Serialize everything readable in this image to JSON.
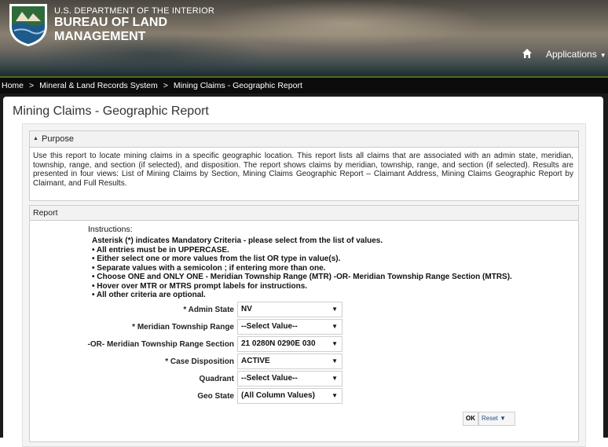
{
  "header": {
    "agency": "U.S. DEPARTMENT OF THE INTERIOR",
    "bureau_line1": "BUREAU OF LAND",
    "bureau_line2": "MANAGEMENT",
    "applications_label": "Applications"
  },
  "breadcrumb": {
    "items": [
      "Home",
      "Mineral & Land Records System",
      "Mining Claims - Geographic Report"
    ],
    "separator": ">"
  },
  "page": {
    "title": "Mining Claims - Geographic Report"
  },
  "purpose": {
    "title": "Purpose",
    "text": "Use this report to locate mining claims in a specific geographic location. This report lists all claims that are associated with an admin state, meridian, township, range, and section (if selected), and disposition. The report shows claims by meridian, township, range, and section (if selected). Results are presented in four views: List of Mining Claims by Section, Mining Claims Geographic Report – Claimant Address, Mining Claims Geographic Report by Claimant, and Full Results."
  },
  "report": {
    "title": "Report",
    "instructions_title": "Instructions:",
    "instructions": [
      "Asterisk (*) indicates Mandatory Criteria - please select from the list of values.",
      "• All entries must be in UPPERCASE.",
      "• Either select one or more values from the list OR type in value(s).",
      "• Separate values with a semicolon ; if entering more than one.",
      "• Choose ONE and ONLY ONE - Meridian Township Range (MTR) -OR- Meridian Township Range Section (MTRS).",
      "• Hover over MTR or MTRS prompt labels for instructions.",
      "• All other criteria are optional."
    ],
    "fields": [
      {
        "label": "* Admin State",
        "value": "NV"
      },
      {
        "label": "* Meridian Township Range",
        "value": "--Select Value--"
      },
      {
        "label": "-OR- Meridian Township Range Section",
        "value": "21 0280N 0290E 030"
      },
      {
        "label": "* Case Disposition",
        "value": "ACTIVE"
      },
      {
        "label": "Quadrant",
        "value": "--Select Value--"
      },
      {
        "label": "Geo State",
        "value": "(All Column Values)"
      }
    ],
    "ok_label": "OK",
    "reset_label": "Reset"
  },
  "colors": {
    "accent_green": "#4f6e1e",
    "link_blue": "#2a4f8a",
    "logo_green": "#2f6b3a"
  }
}
